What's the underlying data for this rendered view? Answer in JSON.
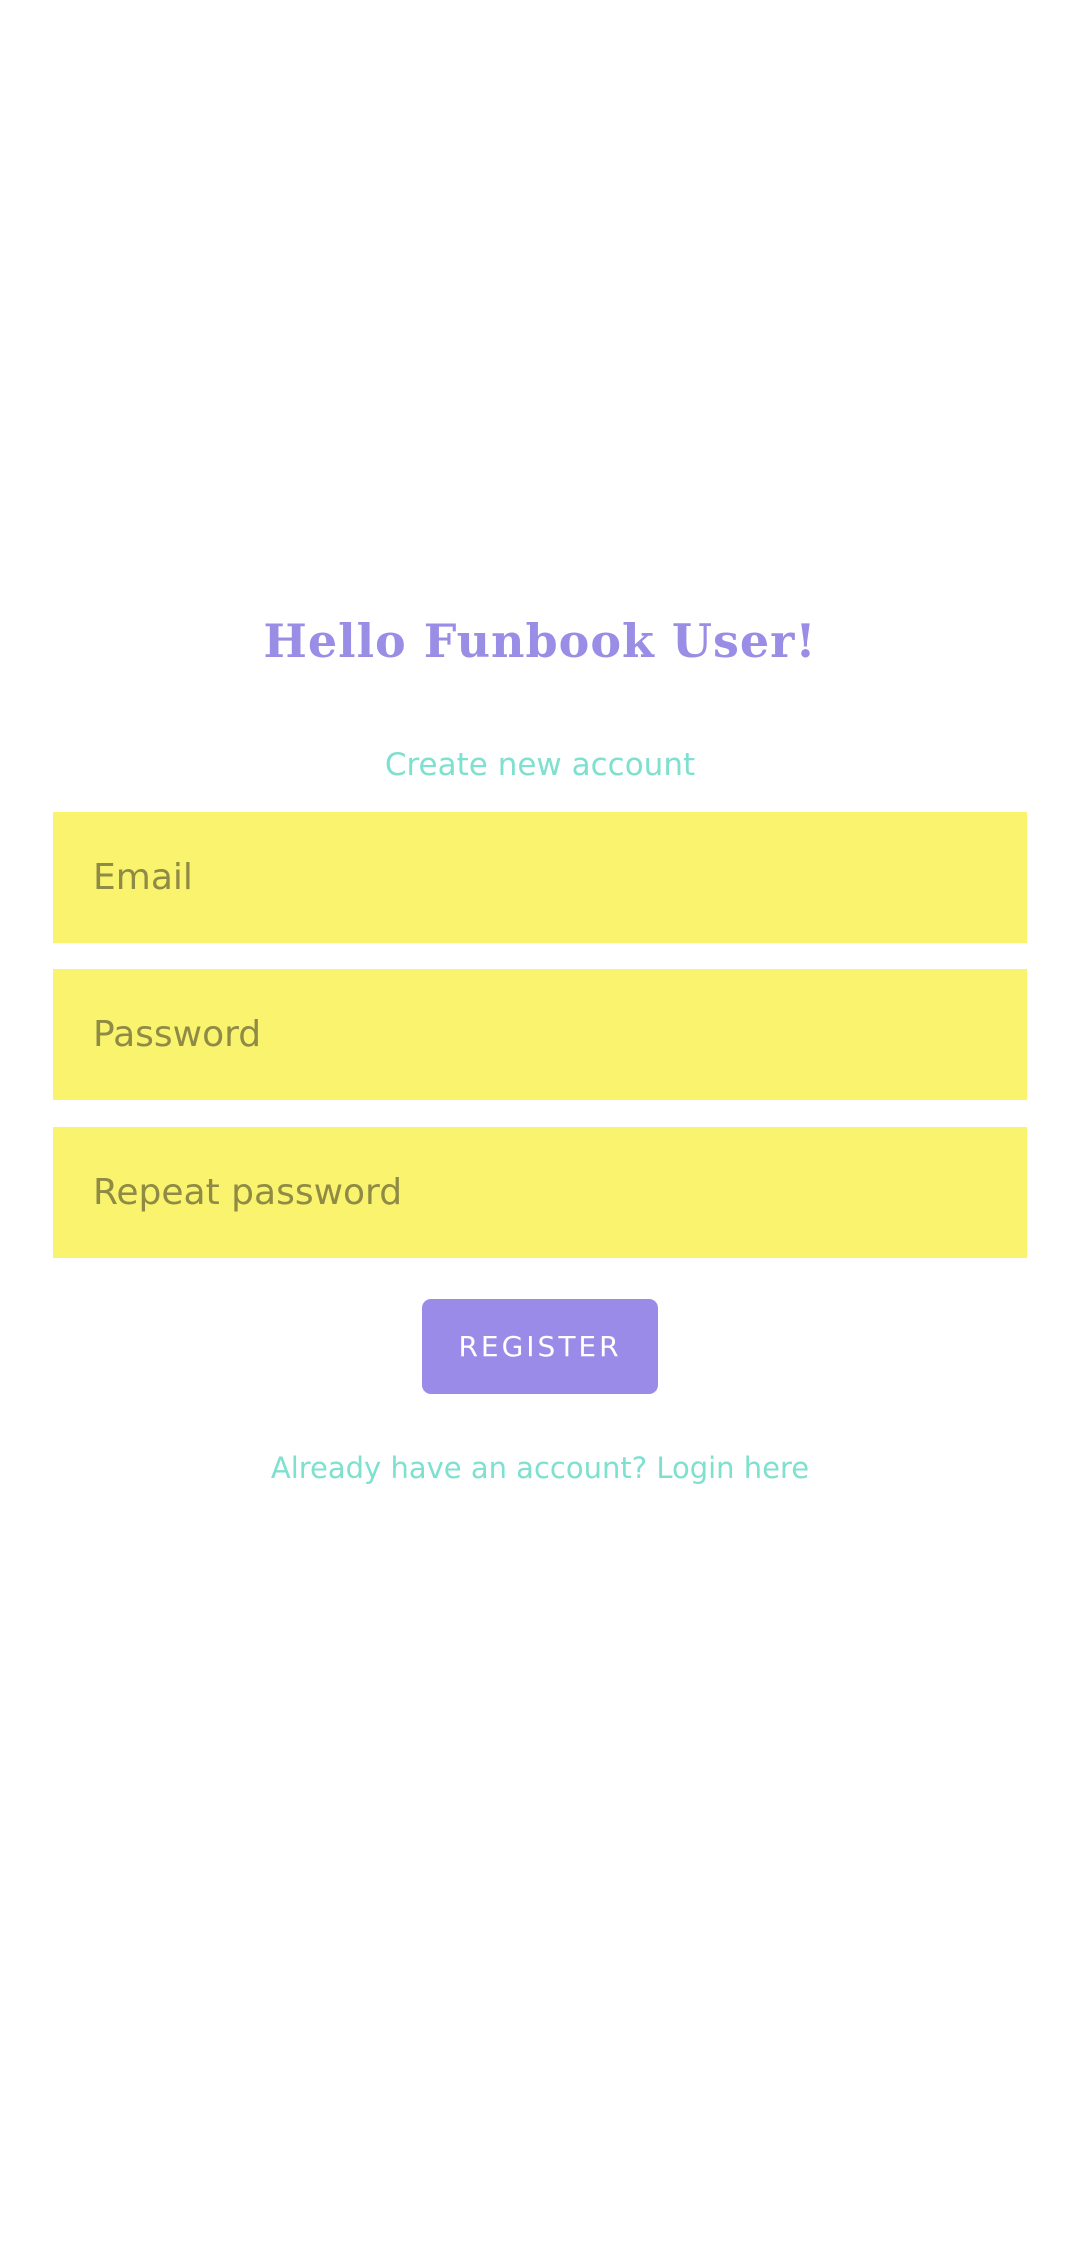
{
  "header": {
    "greeting": "Hello Funbook User!",
    "subtitle": "Create new account"
  },
  "form": {
    "email_placeholder": "Email",
    "password_placeholder": "Password",
    "repeat_password_placeholder": "Repeat password",
    "register_label": "REGISTER"
  },
  "footer": {
    "login_prompt": "Already have an account? Login here"
  },
  "colors": {
    "background": "#ffffff",
    "primary": "#9b8be9",
    "accent": "#7ee0cf",
    "field_background": "#f9f36e",
    "placeholder_text": "#8f8a45"
  }
}
